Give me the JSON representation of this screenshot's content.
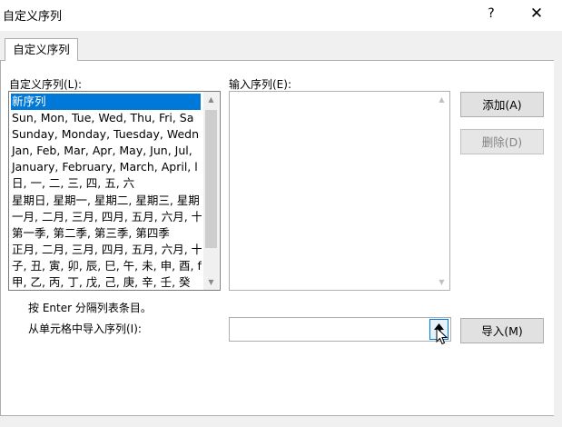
{
  "window": {
    "title": "自定义序列",
    "help_label": "?",
    "close_label": "✕"
  },
  "tab": {
    "label": "自定义序列"
  },
  "custom_lists": {
    "label": "自定义序列(L):",
    "items": [
      "新序列",
      "Sun, Mon, Tue, Wed, Thu, Fri, Sa",
      "Sunday, Monday, Tuesday, Wedn",
      "Jan, Feb, Mar, Apr, May, Jun, Jul,",
      "January, February, March, April, l",
      "日, 一, 二, 三, 四, 五, 六",
      "星期日, 星期一, 星期二, 星期三, 星期",
      "一月, 二月, 三月, 四月, 五月, 六月, 十",
      "第一季, 第二季, 第三季, 第四季",
      "正月, 二月, 三月, 四月, 五月, 六月, 十",
      "子, 丑, 寅, 卯, 辰, 巳, 午, 未, 申, 酉, f",
      "甲, 乙, 丙, 丁, 戊, 己, 庚, 辛, 壬, 癸"
    ],
    "selected_index": 0,
    "scroll_up_icon": "triangle-up-icon",
    "scroll_down_icon": "triangle-down-icon"
  },
  "entries": {
    "label": "输入序列(E):"
  },
  "buttons": {
    "add": "添加(A)",
    "delete": "删除(D)",
    "import": "导入(M)"
  },
  "hint": "按 Enter 分隔列表条目。",
  "import_field": {
    "label": "从单元格中导入序列(I):",
    "value": "",
    "collapse_icon": "range-select-arrow-icon"
  },
  "colors": {
    "selection": "#0078d7",
    "dialog_bg": "#f0f0f0",
    "panel_bg": "#ffffff"
  }
}
